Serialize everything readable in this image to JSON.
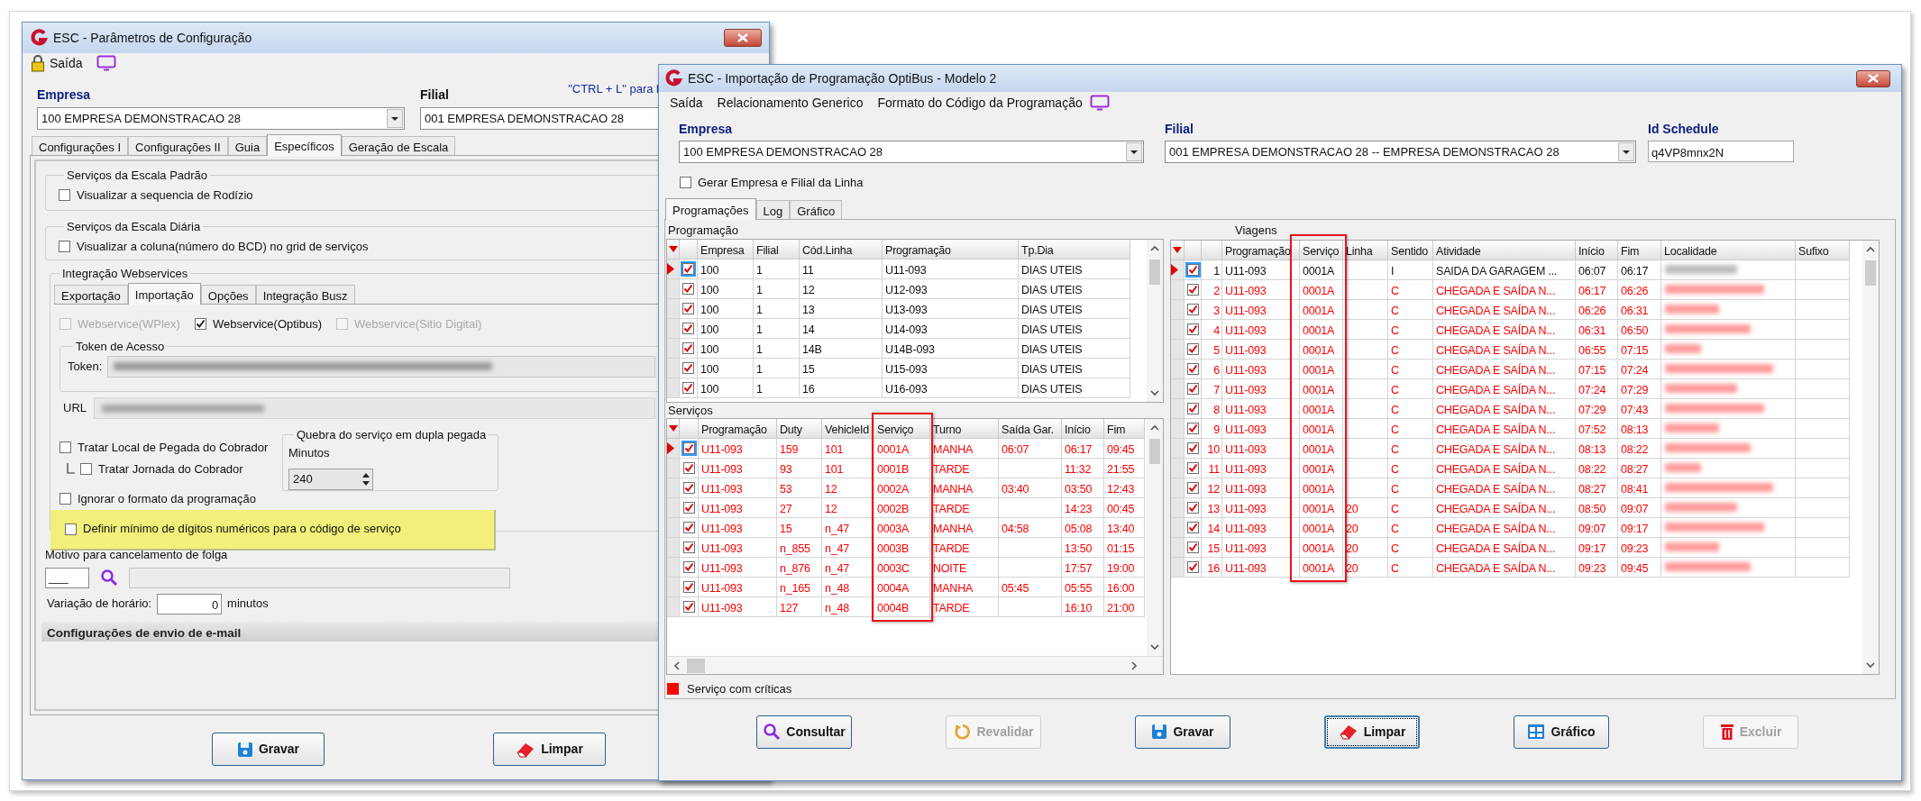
{
  "config_window": {
    "title": "ESC - Parâmetros de Configuração",
    "toolbar": {
      "label": "Saída"
    },
    "empresa": {
      "label": "Empresa",
      "value": "100 EMPRESA DEMONSTRACAO 28"
    },
    "filial": {
      "label": "Filial",
      "value": "001 EMPRESA DEMONSTRACAO 28"
    },
    "shortcut_hint": "\"CTRL + L\" para l",
    "tabs": [
      {
        "label": "Configurações I",
        "selected": false
      },
      {
        "label": "Configurações II",
        "selected": false
      },
      {
        "label": "Guia",
        "selected": false
      },
      {
        "label": "Específicos",
        "selected": true
      },
      {
        "label": "Geração de Escala",
        "selected": false
      }
    ],
    "escala_padrao": {
      "title": "Serviços da Escala Padrão",
      "option": {
        "label": "Visualizar a sequencia de Rodízio",
        "checked": false
      }
    },
    "escala_diaria": {
      "title": "Serviços da Escala Diária",
      "option": {
        "label": "Visualizar a coluna(número do BCD) no grid de serviços",
        "checked": false
      }
    },
    "webservices": {
      "title": "Integração Webservices",
      "tabs": [
        {
          "label": "Exportação",
          "selected": false
        },
        {
          "label": "Importação",
          "selected": true
        },
        {
          "label": "Opções",
          "selected": false
        },
        {
          "label": "Integração Busz",
          "selected": false
        }
      ],
      "services": [
        {
          "label": "Webservice(WPlex)",
          "checked": false,
          "disabled": true
        },
        {
          "label": "Webservice(Optibus)",
          "checked": true,
          "disabled": false
        },
        {
          "label": "Webservice(Sitio Digital)",
          "checked": false,
          "disabled": true
        }
      ],
      "token_group": "Token de Acesso",
      "token_label": "Token:",
      "url_label": "URL",
      "options": [
        {
          "label": "Tratar Local de Pegada do Cobrador",
          "checked": false,
          "children": [
            {
              "label": "Tratar  Jornada do Cobrador",
              "checked": false
            }
          ]
        },
        {
          "label": "Ignorar o formato da programação",
          "checked": false
        }
      ],
      "break_group": {
        "title": "Quebra do serviço em dupla pegada",
        "label": "Minutos",
        "value": "240"
      },
      "digits_option": {
        "label": "Definir mínimo de dígitos numéricos para o código de serviço",
        "checked": false,
        "highlighted": true
      }
    },
    "motivo": {
      "label": "Motivo para cancelamento de folga",
      "code": "___"
    },
    "variacao": {
      "label": "Variação de horário:",
      "value": "0",
      "unit": "minutos"
    },
    "email_section": "Configurações de envio de e-mail",
    "buttons": [
      {
        "label": "Gravar",
        "kind": "save",
        "disabled": false,
        "focused": false
      },
      {
        "label": "Limpar",
        "kind": "eraser",
        "disabled": false,
        "focused": false
      }
    ]
  },
  "import_window": {
    "title": "ESC - Importação de Programação OptiBus - Modelo 2",
    "menu": [
      "Saída",
      "Relacionamento Generico",
      "Formato do Código da Programação"
    ],
    "empresa": {
      "label": "Empresa",
      "value": "100 EMPRESA DEMONSTRACAO 28"
    },
    "filial": {
      "label": "Filial",
      "value": "001 EMPRESA DEMONSTRACAO 28 -- EMPRESA DEMONSTRACAO 28"
    },
    "id_schedule": {
      "label": "Id Schedule",
      "value": "q4VP8mnx2N"
    },
    "gerar": {
      "label": "Gerar Empresa e Filial da Linha",
      "checked": false
    },
    "tabs": [
      {
        "label": "Programações",
        "selected": true
      },
      {
        "label": "Log",
        "selected": false
      },
      {
        "label": "Gráfico",
        "selected": false
      }
    ],
    "programacao": {
      "title": "Programação",
      "columns": [
        {
          "label": "Empresa",
          "highlighted": false
        },
        {
          "label": "Filial",
          "highlighted": false
        },
        {
          "label": "Cód.Linha",
          "highlighted": false
        },
        {
          "label": "Programação",
          "highlighted": false
        },
        {
          "label": "Tp.Dia",
          "highlighted": false
        }
      ],
      "rows": [
        {
          "selected": true,
          "checked": true,
          "critical": false,
          "cells": [
            "100",
            "1",
            "11",
            "U11-093",
            "DIAS UTEIS"
          ]
        },
        {
          "selected": false,
          "checked": true,
          "critical": false,
          "cells": [
            "100",
            "1",
            "12",
            "U12-093",
            "DIAS UTEIS"
          ]
        },
        {
          "selected": false,
          "checked": true,
          "critical": false,
          "cells": [
            "100",
            "1",
            "13",
            "U13-093",
            "DIAS UTEIS"
          ]
        },
        {
          "selected": false,
          "checked": true,
          "critical": false,
          "cells": [
            "100",
            "1",
            "14",
            "U14-093",
            "DIAS UTEIS"
          ]
        },
        {
          "selected": false,
          "checked": true,
          "critical": false,
          "cells": [
            "100",
            "1",
            "14B",
            "U14B-093",
            "DIAS UTEIS"
          ]
        },
        {
          "selected": false,
          "checked": true,
          "critical": false,
          "cells": [
            "100",
            "1",
            "15",
            "U15-093",
            "DIAS UTEIS"
          ]
        },
        {
          "selected": false,
          "checked": true,
          "critical": false,
          "cells": [
            "100",
            "1",
            "16",
            "U16-093",
            "DIAS UTEIS"
          ]
        }
      ]
    },
    "servicos": {
      "title": "Serviços",
      "columns": [
        {
          "label": "Programação",
          "highlighted": false
        },
        {
          "label": "Duty",
          "highlighted": false
        },
        {
          "label": "VehicleId",
          "highlighted": false
        },
        {
          "label": "Serviço",
          "highlighted": true
        },
        {
          "label": "Turno",
          "highlighted": false
        },
        {
          "label": "Saída Gar.",
          "highlighted": false
        },
        {
          "label": "Início",
          "highlighted": false
        },
        {
          "label": "Fim",
          "highlighted": false
        }
      ],
      "rows": [
        {
          "selected": true,
          "checked": true,
          "critical": true,
          "cells": [
            "U11-093",
            "159",
            "101",
            "0001A",
            "MANHA",
            "06:07",
            "06:17",
            "09:45"
          ]
        },
        {
          "selected": false,
          "checked": true,
          "critical": true,
          "cells": [
            "U11-093",
            "93",
            "101",
            "0001B",
            "TARDE",
            null,
            "11:32",
            "21:55"
          ]
        },
        {
          "selected": false,
          "checked": true,
          "critical": true,
          "cells": [
            "U11-093",
            "53",
            "12",
            "0002A",
            "MANHA",
            "03:40",
            "03:50",
            "12:43"
          ]
        },
        {
          "selected": false,
          "checked": true,
          "critical": true,
          "cells": [
            "U11-093",
            "27",
            "12",
            "0002B",
            "TARDE",
            null,
            "14:23",
            "00:45"
          ]
        },
        {
          "selected": false,
          "checked": true,
          "critical": true,
          "cells": [
            "U11-093",
            "15",
            "n_47",
            "0003A",
            "MANHA",
            "04:58",
            "05:08",
            "13:40"
          ]
        },
        {
          "selected": false,
          "checked": true,
          "critical": true,
          "cells": [
            "U11-093",
            "n_855",
            "n_47",
            "0003B",
            "TARDE",
            null,
            "13:50",
            "01:15"
          ]
        },
        {
          "selected": false,
          "checked": true,
          "critical": true,
          "cells": [
            "U11-093",
            "n_876",
            "n_47",
            "0003C",
            "NOITE",
            null,
            "17:57",
            "19:00"
          ]
        },
        {
          "selected": false,
          "checked": true,
          "critical": true,
          "cells": [
            "U11-093",
            "n_165",
            "n_48",
            "0004A",
            "MANHA",
            "05:45",
            "05:55",
            "16:00"
          ]
        },
        {
          "selected": false,
          "checked": true,
          "critical": true,
          "cells": [
            "U11-093",
            "127",
            "n_48",
            "0004B",
            "TARDE",
            null,
            "16:10",
            "21:00"
          ]
        }
      ]
    },
    "legend": {
      "label": "Serviço com críticas",
      "color": "#ff0000"
    },
    "viagens": {
      "title": "Viagens",
      "columns": [
        {
          "label": "Programação",
          "highlighted": false
        },
        {
          "label": "Serviço",
          "highlighted": true
        },
        {
          "label": "Linha",
          "highlighted": false
        },
        {
          "label": "Sentido",
          "highlighted": false
        },
        {
          "label": "Atividade",
          "highlighted": false
        },
        {
          "label": "Início",
          "highlighted": false
        },
        {
          "label": "Fim",
          "highlighted": false
        },
        {
          "label": "Localidade",
          "highlighted": false
        },
        {
          "label": "Sufixo",
          "highlighted": false
        }
      ],
      "rows": [
        {
          "selected": true,
          "checked": true,
          "critical": false,
          "number": "1",
          "cells": [
            "U11-093",
            "0001A",
            null,
            "I",
            "SAIDA DA GARAGEM ...",
            "06:07",
            "06:17"
          ]
        },
        {
          "selected": false,
          "checked": true,
          "critical": true,
          "number": "2",
          "cells": [
            "U11-093",
            "0001A",
            null,
            "C",
            "CHEGADA E SAÍDA N...",
            "06:17",
            "06:26"
          ]
        },
        {
          "selected": false,
          "checked": true,
          "critical": true,
          "number": "3",
          "cells": [
            "U11-093",
            "0001A",
            null,
            "C",
            "CHEGADA E SAÍDA N...",
            "06:26",
            "06:31"
          ]
        },
        {
          "selected": false,
          "checked": true,
          "critical": true,
          "number": "4",
          "cells": [
            "U11-093",
            "0001A",
            null,
            "C",
            "CHEGADA E SAÍDA N...",
            "06:31",
            "06:50"
          ]
        },
        {
          "selected": false,
          "checked": true,
          "critical": true,
          "number": "5",
          "cells": [
            "U11-093",
            "0001A",
            null,
            "C",
            "CHEGADA E SAÍDA N...",
            "06:55",
            "07:15"
          ]
        },
        {
          "selected": false,
          "checked": true,
          "critical": true,
          "number": "6",
          "cells": [
            "U11-093",
            "0001A",
            null,
            "C",
            "CHEGADA E SAÍDA N...",
            "07:15",
            "07:24"
          ]
        },
        {
          "selected": false,
          "checked": true,
          "critical": true,
          "number": "7",
          "cells": [
            "U11-093",
            "0001A",
            null,
            "C",
            "CHEGADA E SAÍDA N...",
            "07:24",
            "07:29"
          ]
        },
        {
          "selected": false,
          "checked": true,
          "critical": true,
          "number": "8",
          "cells": [
            "U11-093",
            "0001A",
            null,
            "C",
            "CHEGADA E SAÍDA N...",
            "07:29",
            "07:43"
          ]
        },
        {
          "selected": false,
          "checked": true,
          "critical": true,
          "number": "9",
          "cells": [
            "U11-093",
            "0001A",
            null,
            "C",
            "CHEGADA E SAÍDA N...",
            "07:52",
            "08:13"
          ]
        },
        {
          "selected": false,
          "checked": true,
          "critical": true,
          "number": "10",
          "cells": [
            "U11-093",
            "0001A",
            null,
            "C",
            "CHEGADA E SAÍDA N...",
            "08:13",
            "08:22"
          ]
        },
        {
          "selected": false,
          "checked": true,
          "critical": true,
          "number": "11",
          "cells": [
            "U11-093",
            "0001A",
            null,
            "C",
            "CHEGADA E SAÍDA N...",
            "08:22",
            "08:27"
          ]
        },
        {
          "selected": false,
          "checked": true,
          "critical": true,
          "number": "12",
          "cells": [
            "U11-093",
            "0001A",
            null,
            "C",
            "CHEGADA E SAÍDA N...",
            "08:27",
            "08:41"
          ]
        },
        {
          "selected": false,
          "checked": true,
          "critical": true,
          "number": "13",
          "cells": [
            "U11-093",
            "0001A",
            "20",
            "C",
            "CHEGADA E SAÍDA N...",
            "08:50",
            "09:07"
          ]
        },
        {
          "selected": false,
          "checked": true,
          "critical": true,
          "number": "14",
          "cells": [
            "U11-093",
            "0001A",
            "20",
            "C",
            "CHEGADA E SAÍDA N...",
            "09:07",
            "09:17"
          ]
        },
        {
          "selected": false,
          "checked": true,
          "critical": true,
          "number": "15",
          "cells": [
            "U11-093",
            "0001A",
            "20",
            "C",
            "CHEGADA E SAÍDA N...",
            "09:17",
            "09:23"
          ]
        },
        {
          "selected": false,
          "checked": true,
          "critical": true,
          "number": "16",
          "cells": [
            "U11-093",
            "0001A",
            "20",
            "C",
            "CHEGADA E SAÍDA N...",
            "09:23",
            "09:45"
          ]
        }
      ]
    },
    "buttons": [
      {
        "label": "Consultar",
        "kind": "search",
        "disabled": false,
        "focused": false
      },
      {
        "label": "Revalidar",
        "kind": "refresh",
        "disabled": true,
        "focused": false
      },
      {
        "label": "Gravar",
        "kind": "save",
        "disabled": false,
        "focused": false
      },
      {
        "label": "Limpar",
        "kind": "eraser",
        "disabled": false,
        "focused": true
      },
      {
        "label": "Gráfico",
        "kind": "chart",
        "disabled": false,
        "focused": false
      },
      {
        "label": "Excluir",
        "kind": "delete",
        "disabled": true,
        "focused": false
      }
    ]
  }
}
